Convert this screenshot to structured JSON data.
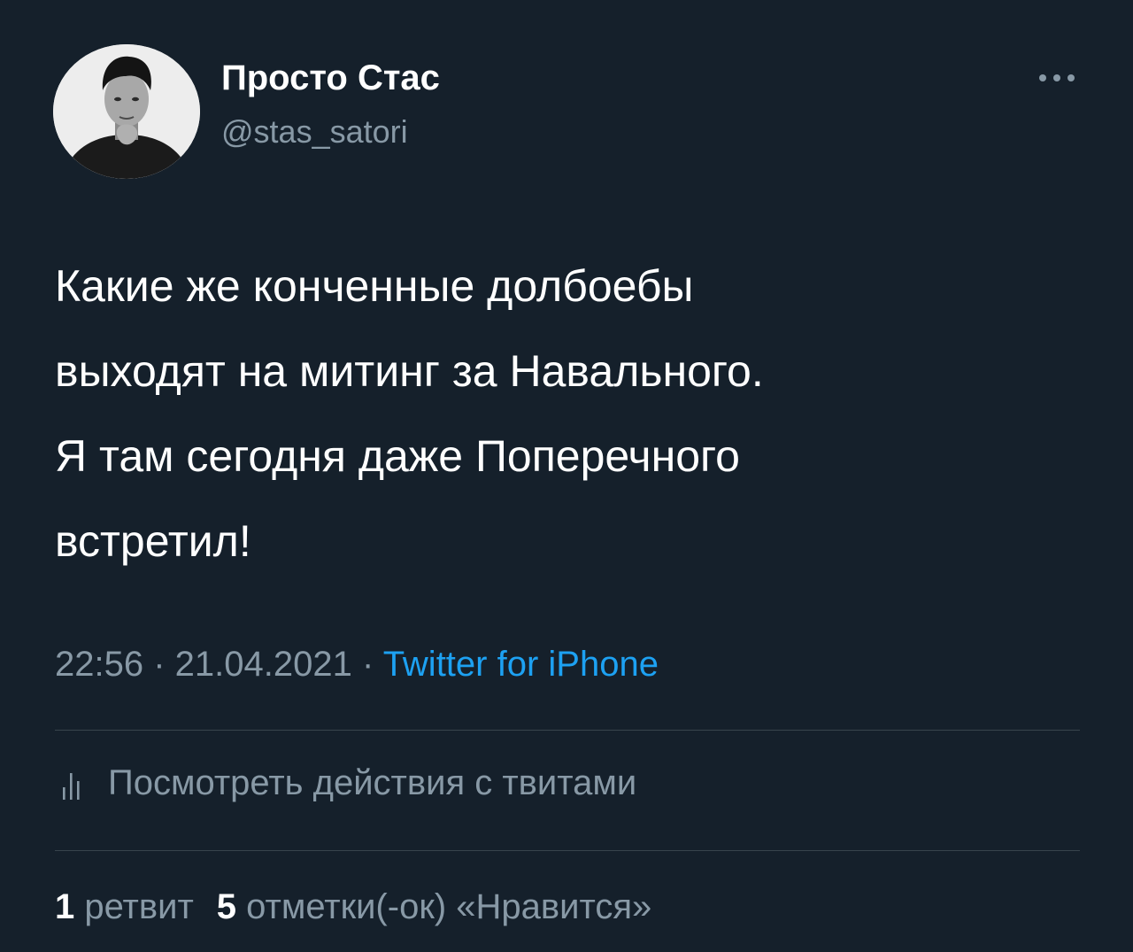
{
  "author": {
    "display_name": "Просто Стас",
    "handle": "@stas_satori"
  },
  "tweet": {
    "lines": [
      "Какие же конченные долбоебы",
      "выходят на митинг за Навального.",
      "Я там сегодня даже Поперечного",
      "встретил!"
    ]
  },
  "meta": {
    "time": "22:56",
    "separator": " · ",
    "date": "21.04.2021",
    "source": "Twitter for iPhone"
  },
  "activity": {
    "label": "Посмотреть действия с твитами"
  },
  "stats": {
    "retweets_count": "1",
    "retweets_label": "ретвит",
    "likes_count": "5",
    "likes_label": "отметки(-ок) «Нравится»"
  },
  "icons": {
    "more": "more-dots-icon",
    "activity": "analytics-bars-icon"
  },
  "colors": {
    "background": "#15202b",
    "primary_text": "#ffffff",
    "secondary_text": "#8899a6",
    "accent": "#1da1f2",
    "divider": "#38444d"
  }
}
